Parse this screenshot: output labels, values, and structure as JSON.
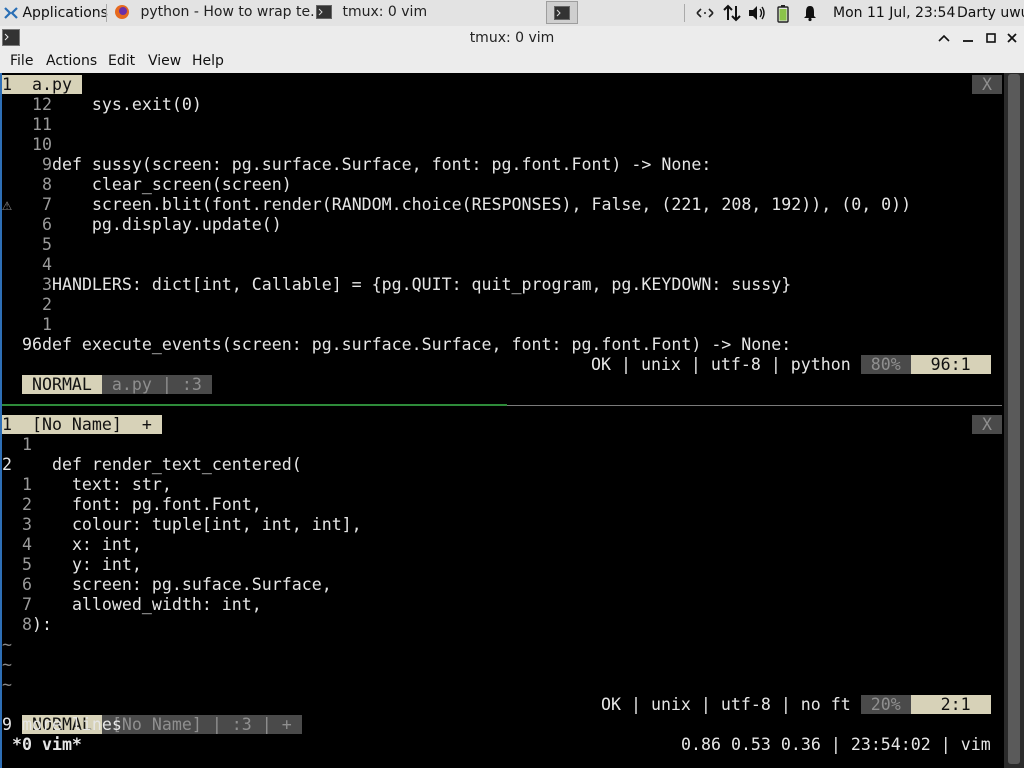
{
  "panel": {
    "applications": "Applications",
    "task_browser": "python - How to wrap te...",
    "task_term": "tmux: 0 vim",
    "clock": "Mon 11 Jul, 23:54",
    "user": "Darty uwu"
  },
  "window": {
    "title": "tmux: 0 vim"
  },
  "menu": {
    "file": "File",
    "actions": "Actions",
    "edit": "Edit",
    "view": "View",
    "help": "Help"
  },
  "tabs": {
    "top_tab": "1  a.py ",
    "top_close": " X ",
    "bottom_tab": "1  [No Name]  + ",
    "bottom_close": " X "
  },
  "top_pane": {
    "lines": [
      {
        "num": "12",
        "code": "    sys.exit(0)"
      },
      {
        "num": "11",
        "code": ""
      },
      {
        "num": "10",
        "code": ""
      },
      {
        "num": "9",
        "code": "def sussy(screen: pg.surface.Surface, font: pg.font.Font) -> None:"
      },
      {
        "num": "8",
        "code": "    clear_screen(screen)"
      },
      {
        "num": "7",
        "code": "    screen.blit(font.render(RANDOM.choice(RESPONSES), False, (221, 208, 192)), (0, 0))"
      },
      {
        "num": "6",
        "code": "    pg.display.update()"
      },
      {
        "num": "5",
        "code": ""
      },
      {
        "num": "4",
        "code": ""
      },
      {
        "num": "3",
        "code": "HANDLERS: dict[int, Callable] = {pg.QUIT: quit_program, pg.KEYDOWN: sussy}"
      },
      {
        "num": "2",
        "code": ""
      },
      {
        "num": "1",
        "code": ""
      },
      {
        "num": "96",
        "code": "def execute_events(screen: pg.surface.Surface, font: pg.font.Font) -> None:"
      }
    ],
    "warn_sign": "⚠",
    "status": {
      "mode": " NORMAL ",
      "file": " a.py | :3 ",
      "right": "OK | unix | utf-8 | python ",
      "percent": " 80% ",
      "pos": "  96:1  "
    }
  },
  "bottom_pane": {
    "lines": [
      {
        "num": "1",
        "code": ""
      },
      {
        "num": "2",
        "code": "def render_text_centered("
      },
      {
        "num": "1",
        "code": "    text: str,"
      },
      {
        "num": "2",
        "code": "    font: pg.font.Font,"
      },
      {
        "num": "3",
        "code": "    colour: tuple[int, int, int],"
      },
      {
        "num": "4",
        "code": "    x: int,"
      },
      {
        "num": "5",
        "code": "    y: int,"
      },
      {
        "num": "6",
        "code": "    screen: pg.suface.Surface,"
      },
      {
        "num": "7",
        "code": "    allowed_width: int,"
      },
      {
        "num": "8",
        "code": "):"
      }
    ],
    "tildes": [
      "~",
      "~",
      "~"
    ],
    "status": {
      "mode": " NORMAL ",
      "file": " [No Name] | :3 | + ",
      "right": "OK | unix | utf-8 | no ft ",
      "percent": " 20% ",
      "pos": "   2:1  "
    },
    "message": "9 more lines"
  },
  "tmux": {
    "left": " *0 vim*",
    "right": "0.86 0.53 0.36 | 23:54:02 | vim "
  },
  "colors": {
    "tab_bg": "#d7d2b8",
    "accent": "#2e6fb6",
    "separator_green": "#2e8b3a"
  }
}
